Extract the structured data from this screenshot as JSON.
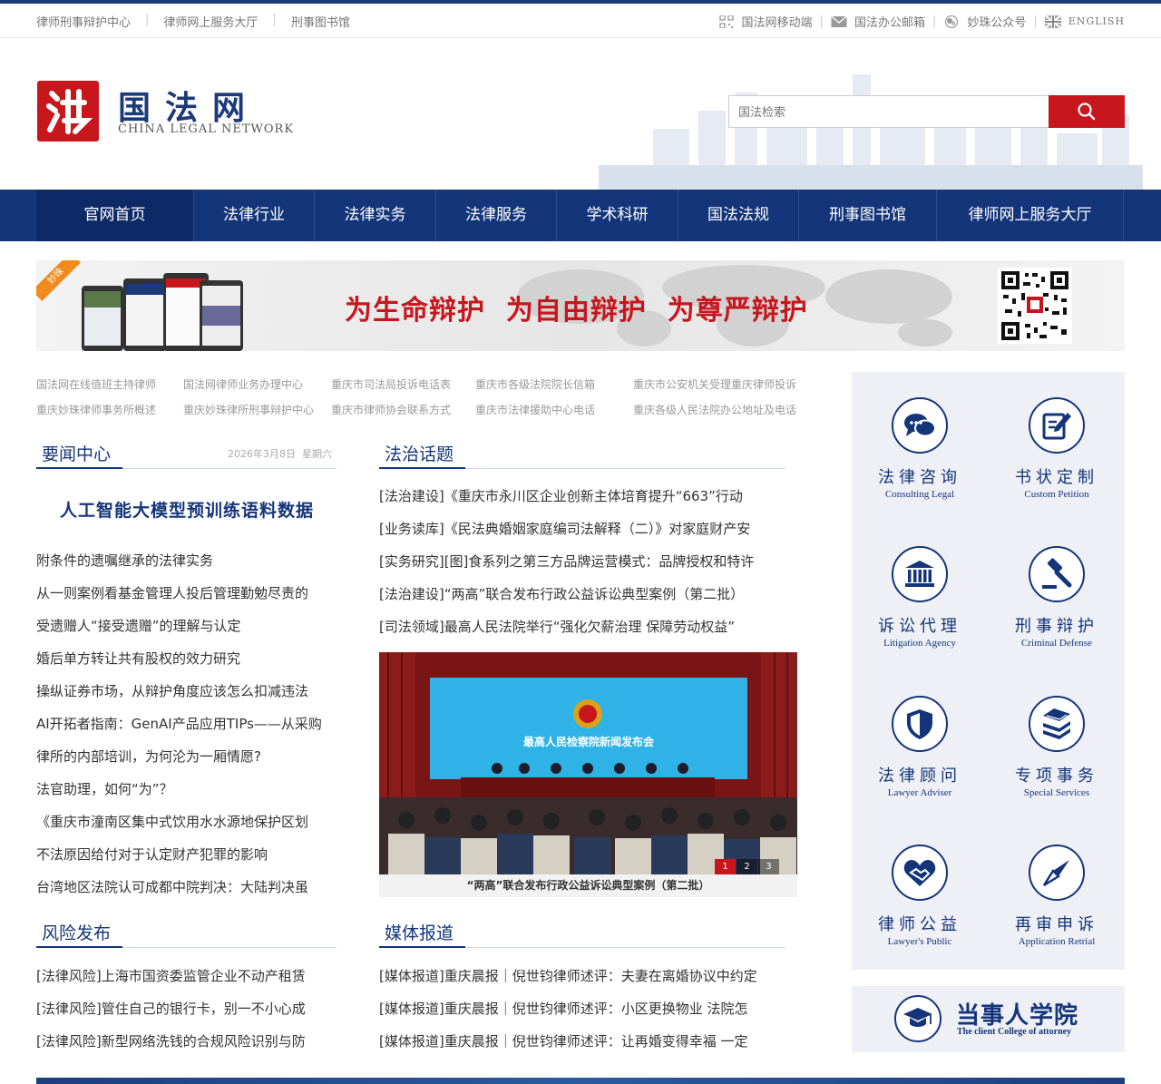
{
  "topbar": {
    "left_links": [
      "律师刑事辩护中心",
      "律师网上服务大厅",
      "刑事图书馆"
    ],
    "right_links": [
      {
        "label": "国法网移动端",
        "icon": "qrcode-icon"
      },
      {
        "label": "国法办公邮箱",
        "icon": "mail-icon"
      },
      {
        "label": "妙珠公众号",
        "icon": "wechat-icon"
      },
      {
        "label": "ENGLISH",
        "icon": "uk-flag-icon"
      }
    ]
  },
  "header": {
    "logo_cn": "国法网",
    "logo_en": "CHINA LEGAL NETWORK",
    "search_placeholder": "国法检索"
  },
  "nav": {
    "items": [
      "官网首页",
      "法律行业",
      "法律实务",
      "法律服务",
      "学术科研",
      "国法法规",
      "刑事图书馆",
      "律师网上服务大厅"
    ]
  },
  "banner": {
    "slogan": "为生命辩护  为自由辩护  为尊严辩护",
    "ribbon": "妙珠"
  },
  "quick_links": [
    [
      "国法网在线值班主持律师",
      "国法网律师业务办理中心",
      "重庆市司法局投诉电话表",
      "重庆市各级法院院长信箱",
      "重庆市公安机关受理重庆律师投诉"
    ],
    [
      "重庆妙珠律师事务所概述",
      "重庆妙珠律所刑事辩护中心",
      "重庆市律师协会联系方式",
      "重庆市法律援助中心电话",
      "重庆各级人民法院办公地址及电话"
    ]
  ],
  "news_center": {
    "title": "要闻中心",
    "date": "2026年3月8日  星期六",
    "headline": "人工智能大模型预训练语料数据",
    "items": [
      "附条件的遗嘱继承的法律实务",
      "从一则案例看基金管理人投后管理勤勉尽责的",
      "受遗赠人“接受遗赠”的理解与认定",
      "婚后单方转让共有股权的效力研究",
      "操纵证券市场，从辩护角度应该怎么扣减违法",
      "AI开拓者指南：GenAI产品应用TIPs——从采购",
      "律所的内部培训，为何沦为一厢情愿?",
      "法官助理，如何“为”？",
      "《重庆市潼南区集中式饮用水水源地保护区划",
      "不法原因给付对于认定财产犯罪的影响",
      "台湾地区法院认可成都中院判决：大陆判决虽"
    ]
  },
  "law_topics": {
    "title": "法治话题",
    "items": [
      "[法治建设]《重庆市永川区企业创新主体培育提升“663”行动",
      "[业务读库]《民法典婚姻家庭编司法解释（二）》对家庭财产安",
      "[实务研究][图]食系列之第三方品牌运营模式：品牌授权和特许",
      "[法治建设]“两高”联合发布行政公益诉讼典型案例（第二批）",
      "[司法领域]最高人民法院举行“强化欠薪治理 保障劳动权益”"
    ],
    "photo_screen_text": "最高人民检察院新闻发布会",
    "photo_caption": "“两高”联合发布行政公益诉讼典型案例（第二批）",
    "slides": [
      "1",
      "2",
      "3"
    ]
  },
  "risk": {
    "title": "风险发布",
    "items": [
      "[法律风险]上海市国资委监管企业不动产租赁",
      "[法律风险]管住自己的银行卡，别一不小心成",
      "[法律风险]新型网络洗钱的合规风险识别与防"
    ]
  },
  "media": {
    "title": "媒体报道",
    "items": [
      "[媒体报道]重庆晨报｜倪世钧律师述评：夫妻在离婚协议中约定",
      "[媒体报道]重庆晨报｜倪世钧律师述评：小区更换物业 法院怎",
      "[媒体报道]重庆晨报｜倪世钧律师述评：让再婚变得幸福 一定"
    ]
  },
  "services": [
    {
      "cn": "法律咨询",
      "en": "Consulting Legal",
      "icon": "chat-icon"
    },
    {
      "cn": "书状定制",
      "en": "Custom Petition",
      "icon": "edit-icon"
    },
    {
      "cn": "诉讼代理",
      "en": "Litigation Agency",
      "icon": "court-icon"
    },
    {
      "cn": "刑事辩护",
      "en": "Criminal Defense",
      "icon": "gavel-icon"
    },
    {
      "cn": "法律顾问",
      "en": "Lawyer Adviser",
      "icon": "shield-icon"
    },
    {
      "cn": "专项事务",
      "en": "Special Services",
      "icon": "books-icon"
    },
    {
      "cn": "律师公益",
      "en": "Lawyer's Public",
      "icon": "heart-handshake-icon"
    },
    {
      "cn": "再审申诉",
      "en": "Application Retrial",
      "icon": "compass-icon"
    }
  ],
  "college": {
    "cn": "当事人学院",
    "en": "The client College of attorney",
    "icon": "graduation-cap-icon"
  },
  "colors": {
    "brand_blue": "#14357a",
    "brand_red": "#c8161d"
  }
}
